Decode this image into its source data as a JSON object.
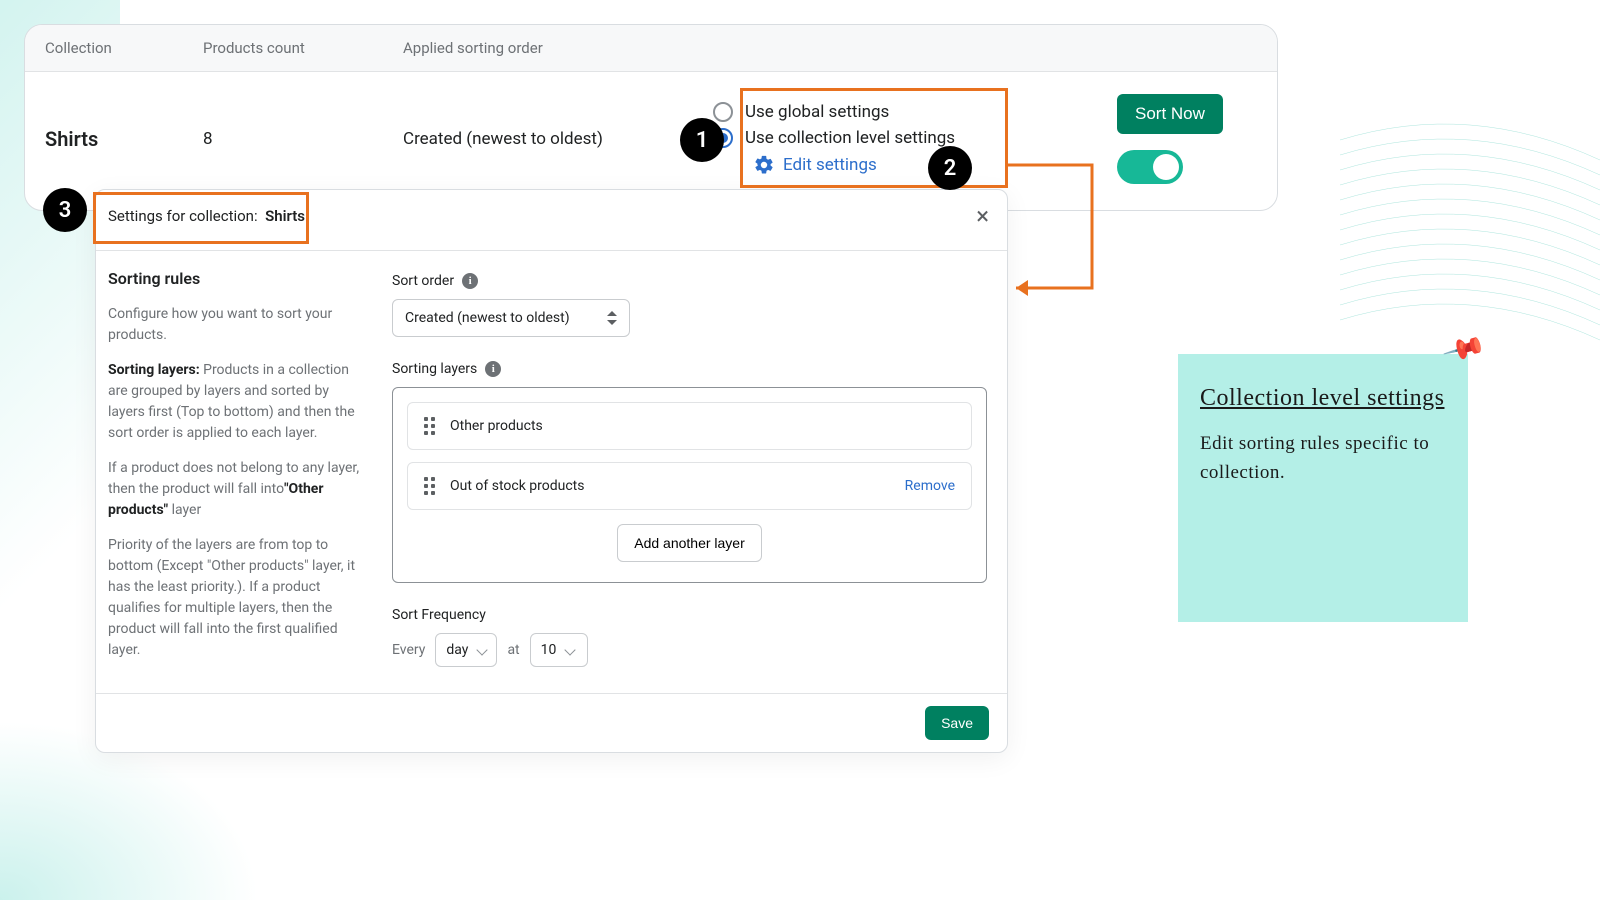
{
  "table": {
    "headers": {
      "collection": "Collection",
      "count": "Products count",
      "sort": "Applied sorting order"
    },
    "row": {
      "collection_name": "Shirts",
      "product_count": "8",
      "applied_sort": "Created (newest to oldest)",
      "radio_global": "Use global settings",
      "radio_collection": "Use collection level settings",
      "edit_settings": "Edit settings",
      "sort_now": "Sort Now"
    }
  },
  "badges": {
    "one": "1",
    "two": "2",
    "three": "3"
  },
  "modal": {
    "title_prefix": "Settings for collection:",
    "title_value": "Shirts",
    "left": {
      "heading": "Sorting rules",
      "p1": "Configure how you want to sort your products.",
      "p2_label": "Sorting layers:",
      "p2_rest": " Products in a collection are grouped by layers and sorted by layers first (Top to bottom) and then the sort order is applied to each layer.",
      "p3a": "If a product does not belong to any layer, then the product will fall into",
      "p3b": "\"Other products\"",
      "p3c": " layer",
      "p4": "Priority of the layers are from top to bottom (Except \"Other products\" layer, it has the least priority.). If a product qualifies for multiple layers, then the product will fall into the first qualified layer."
    },
    "right": {
      "sort_order_label": "Sort order",
      "sort_order_value": "Created (newest to oldest)",
      "sorting_layers_label": "Sorting layers",
      "layer1": "Other products",
      "layer2": "Out of stock products",
      "remove": "Remove",
      "add_layer": "Add another layer",
      "sort_freq_label": "Sort Frequency",
      "freq_every": "Every",
      "freq_unit": "day",
      "freq_at": "at",
      "freq_time": "10",
      "save": "Save"
    }
  },
  "sticky": {
    "title": "Collection level settings",
    "body": "Edit sorting rules specific to collection."
  }
}
